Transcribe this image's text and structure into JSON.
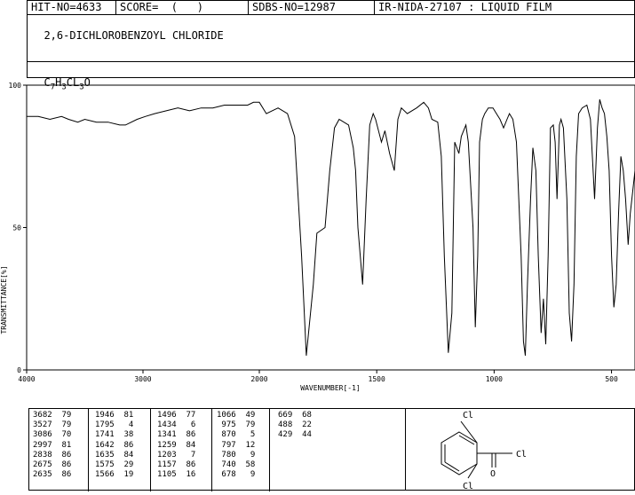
{
  "header": {
    "hit_no": "HIT-NO=4633",
    "score": "SCORE=  (   )",
    "sdbs_no": "SDBS-NO=12987",
    "source": "IR-NIDA-27107 : LIQUID FILM",
    "compound_name": "2,6-DICHLOROBENZOYL CHLORIDE",
    "formula": {
      "c": "C",
      "c_n": "7",
      "h": "H",
      "h_n": "3",
      "cl": "CL",
      "cl_n": "3",
      "o": "O"
    }
  },
  "chart_data": {
    "type": "line",
    "xlabel": "WAVENUMBER[-1]",
    "ylabel": "TRANSMITTANCE[%]",
    "xlim": [
      4000,
      400
    ],
    "ylim": [
      0,
      100
    ],
    "x_ticks": [
      "4000",
      "3000",
      "2000",
      "1500",
      "1000",
      "500"
    ],
    "y_ticks": [
      "0",
      "50",
      "100"
    ],
    "baseline": [
      [
        4000,
        89
      ],
      [
        3900,
        89
      ],
      [
        3800,
        88
      ],
      [
        3700,
        89
      ],
      [
        3640,
        88
      ],
      [
        3560,
        87
      ],
      [
        3500,
        88
      ],
      [
        3400,
        87
      ],
      [
        3300,
        87
      ],
      [
        3200,
        86
      ],
      [
        3150,
        86
      ],
      [
        3050,
        88
      ],
      [
        2980,
        89
      ],
      [
        2900,
        90
      ],
      [
        2800,
        91
      ],
      [
        2700,
        92
      ],
      [
        2600,
        91
      ],
      [
        2500,
        92
      ],
      [
        2400,
        92
      ],
      [
        2300,
        93
      ],
      [
        2200,
        93
      ],
      [
        2100,
        93
      ],
      [
        2050,
        94
      ],
      [
        2000,
        94
      ],
      [
        1970,
        90
      ],
      [
        1920,
        92
      ],
      [
        1880,
        90
      ],
      [
        1850,
        82
      ],
      [
        1820,
        40
      ],
      [
        1800,
        5
      ],
      [
        1770,
        30
      ],
      [
        1755,
        48
      ],
      [
        1720,
        50
      ],
      [
        1700,
        70
      ],
      [
        1680,
        85
      ],
      [
        1660,
        88
      ],
      [
        1620,
        86
      ],
      [
        1600,
        78
      ],
      [
        1590,
        70
      ],
      [
        1580,
        50
      ],
      [
        1560,
        30
      ],
      [
        1545,
        60
      ],
      [
        1530,
        86
      ],
      [
        1515,
        90
      ],
      [
        1505,
        88
      ],
      [
        1480,
        80
      ],
      [
        1465,
        84
      ],
      [
        1445,
        76
      ],
      [
        1425,
        70
      ],
      [
        1410,
        88
      ],
      [
        1395,
        92
      ],
      [
        1370,
        90
      ],
      [
        1330,
        92
      ],
      [
        1300,
        94
      ],
      [
        1280,
        92
      ],
      [
        1265,
        88
      ],
      [
        1240,
        87
      ],
      [
        1225,
        75
      ],
      [
        1212,
        40
      ],
      [
        1195,
        6
      ],
      [
        1180,
        20
      ],
      [
        1168,
        80
      ],
      [
        1150,
        76
      ],
      [
        1140,
        82
      ],
      [
        1120,
        86
      ],
      [
        1110,
        80
      ],
      [
        1090,
        50
      ],
      [
        1080,
        15
      ],
      [
        1070,
        40
      ],
      [
        1062,
        80
      ],
      [
        1050,
        88
      ],
      [
        1040,
        90
      ],
      [
        1025,
        92
      ],
      [
        1005,
        92
      ],
      [
        990,
        90
      ],
      [
        975,
        88
      ],
      [
        960,
        85
      ],
      [
        945,
        88
      ],
      [
        935,
        90
      ],
      [
        920,
        88
      ],
      [
        905,
        80
      ],
      [
        885,
        40
      ],
      [
        875,
        10
      ],
      [
        867,
        5
      ],
      [
        858,
        30
      ],
      [
        845,
        60
      ],
      [
        835,
        78
      ],
      [
        822,
        70
      ],
      [
        812,
        40
      ],
      [
        800,
        13
      ],
      [
        790,
        25
      ],
      [
        780,
        9
      ],
      [
        770,
        40
      ],
      [
        760,
        85
      ],
      [
        748,
        86
      ],
      [
        740,
        80
      ],
      [
        732,
        60
      ],
      [
        722,
        86
      ],
      [
        715,
        88
      ],
      [
        705,
        85
      ],
      [
        690,
        60
      ],
      [
        680,
        20
      ],
      [
        670,
        10
      ],
      [
        660,
        30
      ],
      [
        650,
        75
      ],
      [
        640,
        90
      ],
      [
        625,
        92
      ],
      [
        605,
        93
      ],
      [
        590,
        88
      ],
      [
        572,
        60
      ],
      [
        560,
        85
      ],
      [
        550,
        95
      ],
      [
        540,
        92
      ],
      [
        530,
        90
      ],
      [
        520,
        82
      ],
      [
        510,
        70
      ],
      [
        500,
        40
      ],
      [
        490,
        22
      ],
      [
        480,
        30
      ],
      [
        470,
        55
      ],
      [
        460,
        75
      ],
      [
        450,
        70
      ],
      [
        440,
        60
      ],
      [
        429,
        44
      ],
      [
        420,
        55
      ],
      [
        400,
        70
      ]
    ]
  },
  "peaks": {
    "col1": [
      "3682  79",
      "3527  79",
      "3086  70",
      "2997  81",
      "2838  86",
      "2675  86",
      "2635  86"
    ],
    "col2": [
      "1946  81",
      "1795   4",
      "1741  38",
      "1642  86",
      "1635  84",
      "1575  29",
      "1566  19"
    ],
    "col3": [
      "1496  77",
      "1434   6",
      "1341  86",
      "1259  84",
      "1203   7",
      "1157  86",
      "1105  16"
    ],
    "col4": [
      "1066  49",
      " 975  79",
      " 870   5",
      " 797  12",
      " 780   9",
      " 740  58",
      " 678   9"
    ],
    "col5": [
      "669  68",
      "488  22",
      "429  44"
    ]
  },
  "structure": {
    "cl_top": "Cl",
    "cl_right": "Cl",
    "cl_bottom": "Cl",
    "o": "O"
  }
}
